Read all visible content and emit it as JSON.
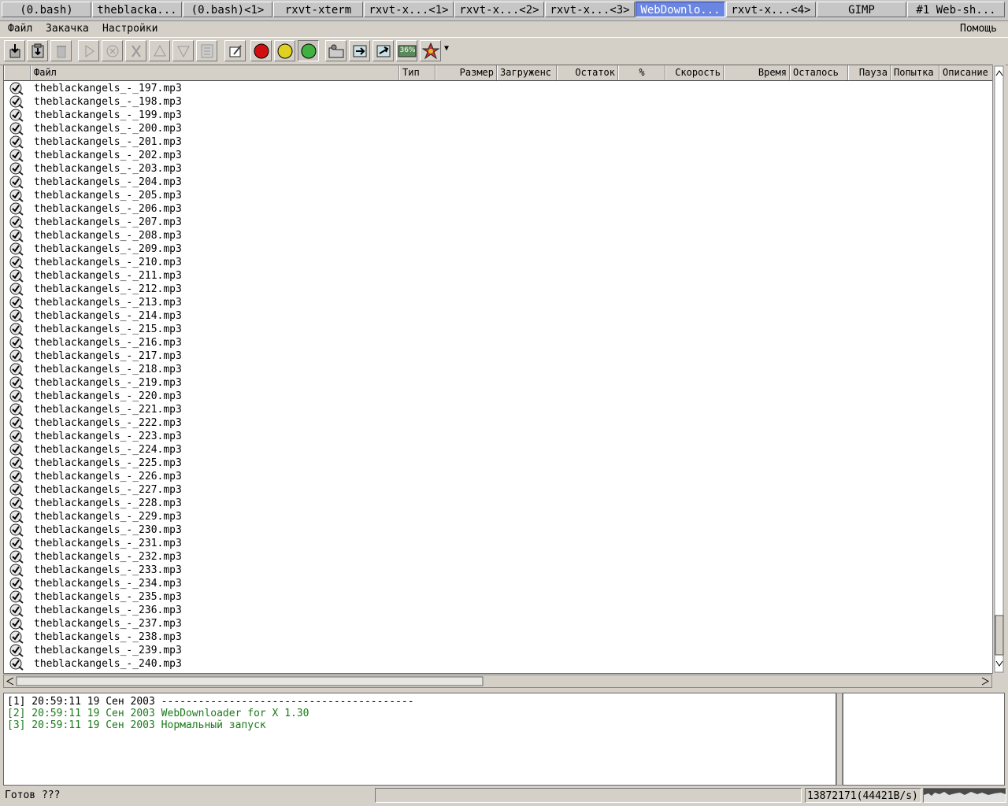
{
  "taskbar": {
    "tasks": [
      "(0.bash)",
      "theblacka...",
      "(0.bash)<1>",
      "rxvt-xterm",
      "rxvt-x...<1>",
      "rxvt-x...<2>",
      "rxvt-x...<3>",
      "WebDownlo...",
      "rxvt-x...<4>",
      "GIMP",
      "#1 Web-sh..."
    ],
    "active_index": 7
  },
  "menubar": {
    "file": "Файл",
    "download": "Закачка",
    "settings": "Настройки",
    "help": "Помощь"
  },
  "toolbar": {
    "icons": [
      "add-download-icon",
      "paste-download-icon",
      "delete-icon",
      "run-icon",
      "stop-icon",
      "cut-icon",
      "move-up-icon",
      "move-down-icon",
      "scheduler-icon",
      "edit-icon",
      "red-light-icon",
      "yellow-light-icon",
      "green-light-icon",
      "open-folder-icon",
      "import-icon",
      "export-icon",
      "speed-meter-icon",
      "pause-all-icon"
    ],
    "speed_meter_label": "36%",
    "menu_arrow": "▼"
  },
  "table": {
    "columns": [
      "Файл",
      "Тип",
      "Размер",
      "Загруженс",
      "Остаток",
      "%",
      "Скорость",
      "Время",
      "Осталось",
      "Пауза",
      "Попытка",
      "Описание"
    ],
    "rows": [
      "theblackangels_-_197.mp3",
      "theblackangels_-_198.mp3",
      "theblackangels_-_199.mp3",
      "theblackangels_-_200.mp3",
      "theblackangels_-_201.mp3",
      "theblackangels_-_202.mp3",
      "theblackangels_-_203.mp3",
      "theblackangels_-_204.mp3",
      "theblackangels_-_205.mp3",
      "theblackangels_-_206.mp3",
      "theblackangels_-_207.mp3",
      "theblackangels_-_208.mp3",
      "theblackangels_-_209.mp3",
      "theblackangels_-_210.mp3",
      "theblackangels_-_211.mp3",
      "theblackangels_-_212.mp3",
      "theblackangels_-_213.mp3",
      "theblackangels_-_214.mp3",
      "theblackangels_-_215.mp3",
      "theblackangels_-_216.mp3",
      "theblackangels_-_217.mp3",
      "theblackangels_-_218.mp3",
      "theblackangels_-_219.mp3",
      "theblackangels_-_220.mp3",
      "theblackangels_-_221.mp3",
      "theblackangels_-_222.mp3",
      "theblackangels_-_223.mp3",
      "theblackangels_-_224.mp3",
      "theblackangels_-_225.mp3",
      "theblackangels_-_226.mp3",
      "theblackangels_-_227.mp3",
      "theblackangels_-_228.mp3",
      "theblackangels_-_229.mp3",
      "theblackangels_-_230.mp3",
      "theblackangels_-_231.mp3",
      "theblackangels_-_232.mp3",
      "theblackangels_-_233.mp3",
      "theblackangels_-_234.mp3",
      "theblackangels_-_235.mp3",
      "theblackangels_-_236.mp3",
      "theblackangels_-_237.mp3",
      "theblackangels_-_238.mp3",
      "theblackangels_-_239.mp3",
      "theblackangels_-_240.mp3"
    ],
    "row_icon": "completed-check-icon"
  },
  "log": {
    "lines": [
      {
        "text": "[1] 20:59:11 19 Сен 2003 -----------------------------------------",
        "color": "#000000"
      },
      {
        "text": "[2] 20:59:11 19 Сен 2003 WebDownloader for X 1.30",
        "color": "#1a7a1a"
      },
      {
        "text": "[3] 20:59:11 19 Сен 2003 Нормальный запуск",
        "color": "#1a7a1a"
      }
    ]
  },
  "statusbar": {
    "status": "Готов ???",
    "traffic": "13872171(44421B/s)"
  },
  "colors": {
    "active_task": "#6a86e0",
    "log_green": "#1a7a1a",
    "window_bg": "#d4d0c8"
  }
}
